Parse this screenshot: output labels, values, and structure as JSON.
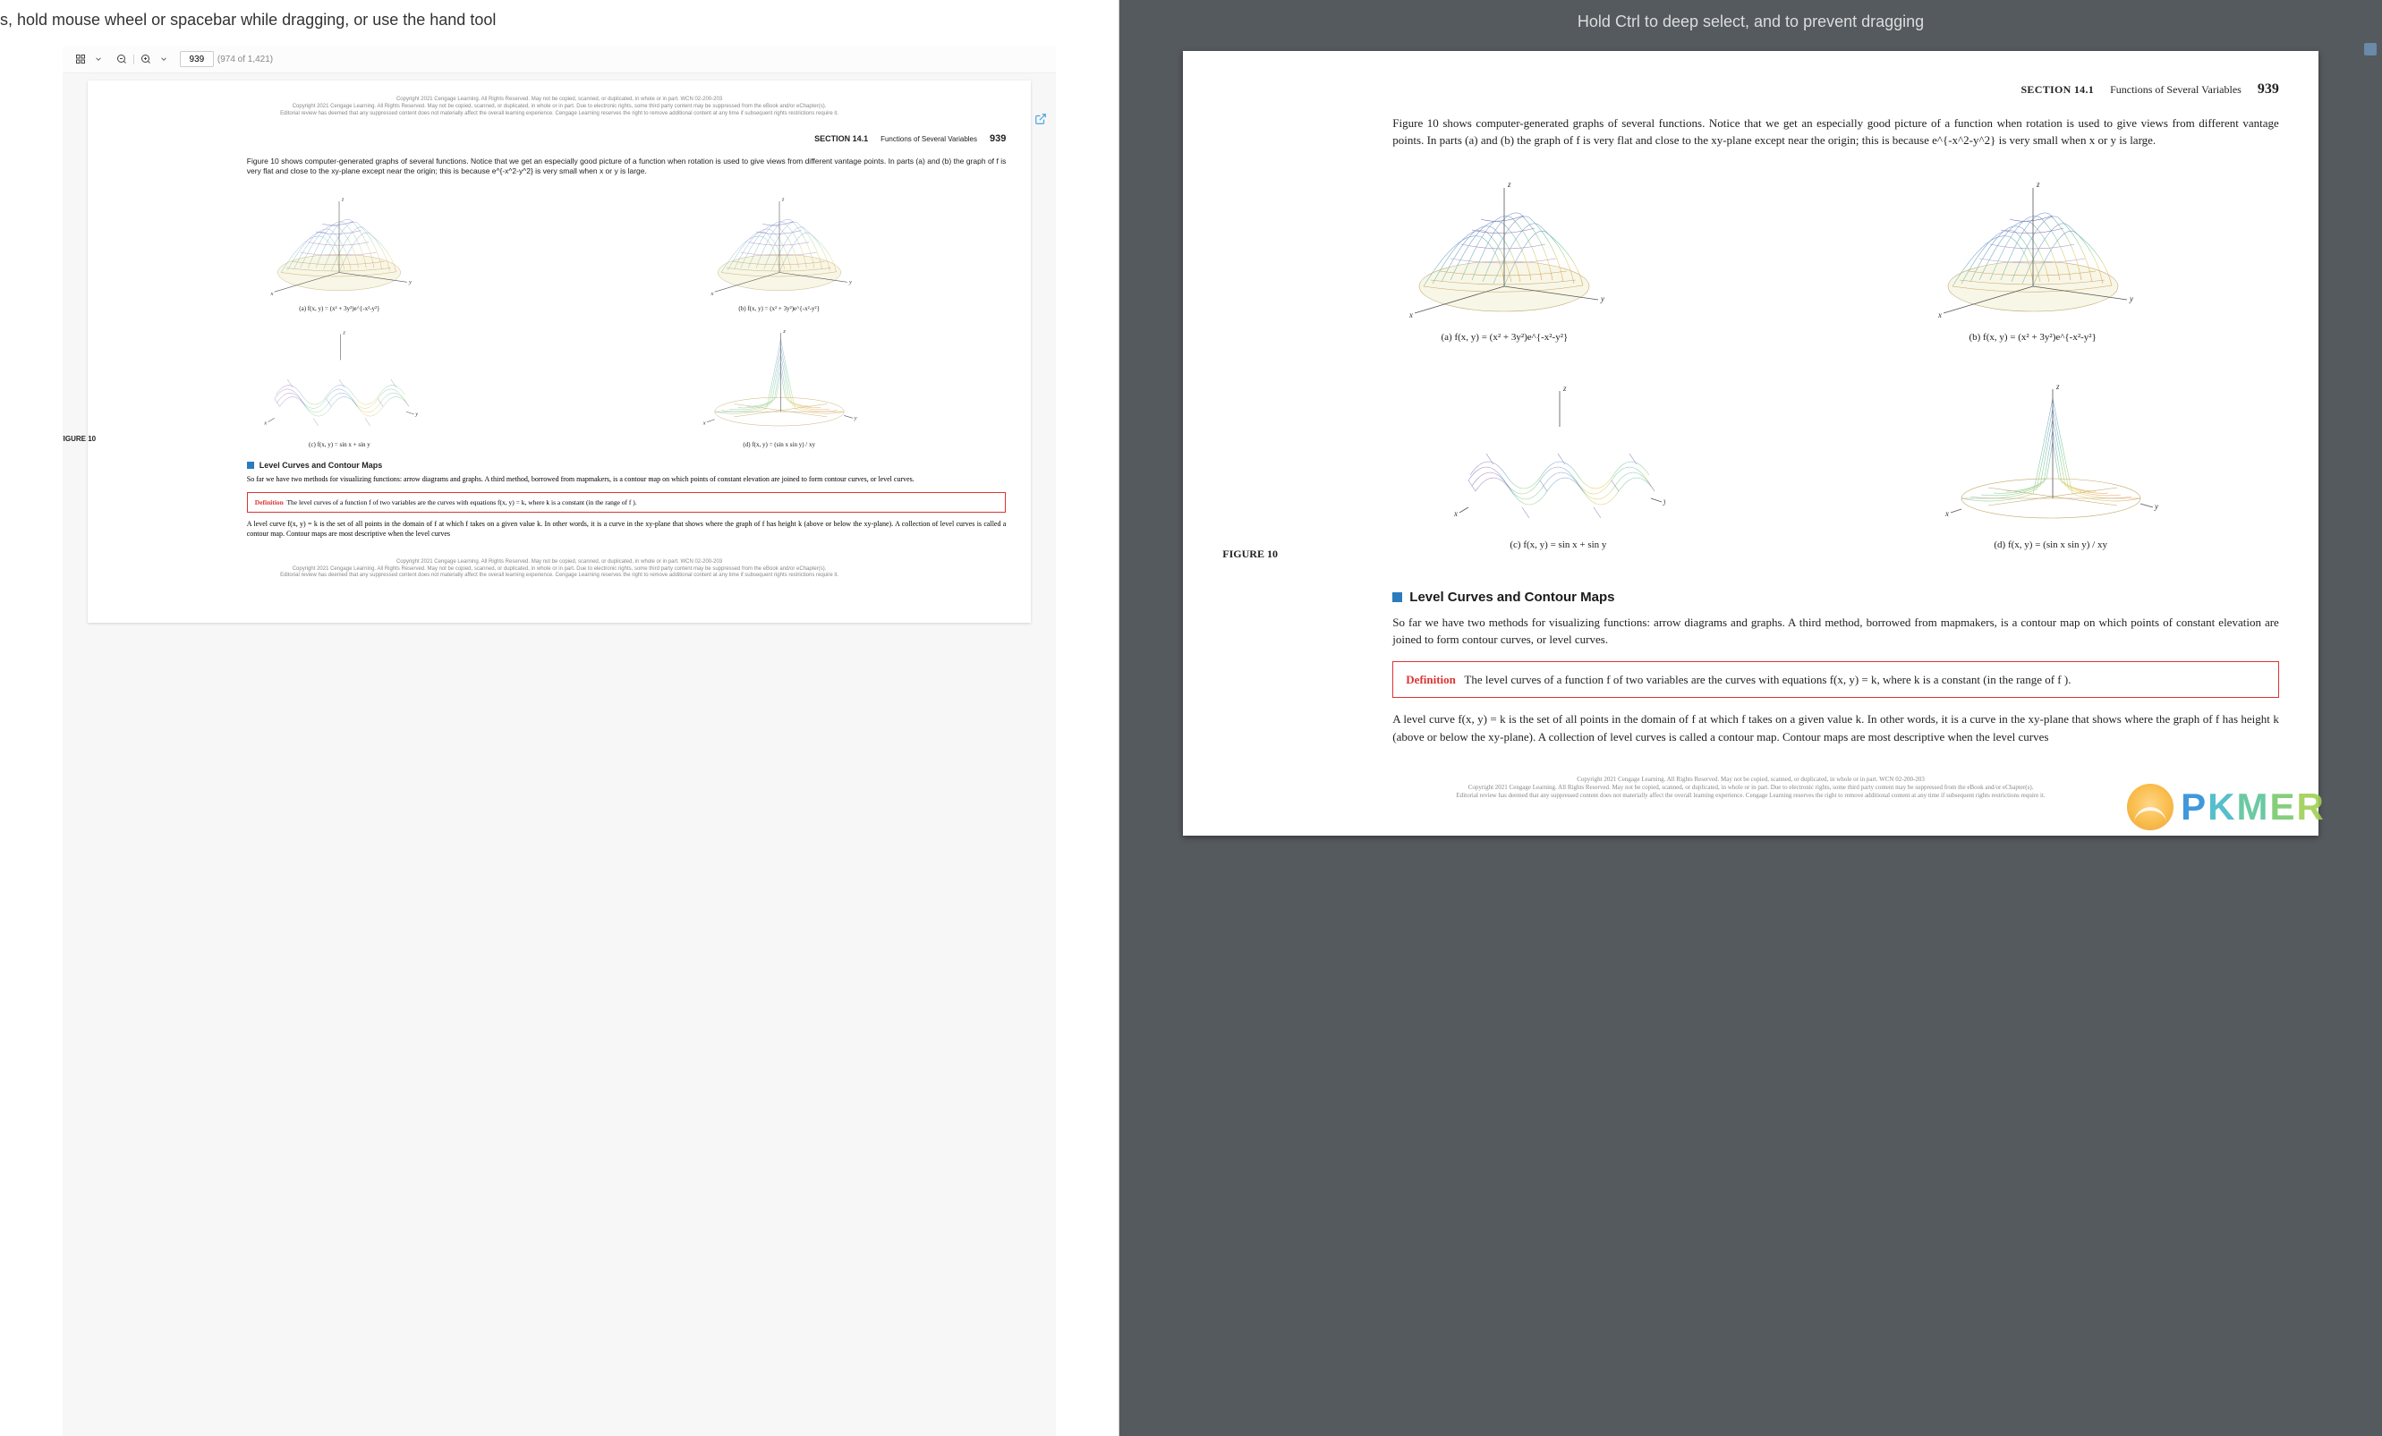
{
  "hints": {
    "left": "s, hold mouse wheel or spacebar while dragging, or use the hand tool",
    "right": "Hold Ctrl to deep select, and to prevent dragging"
  },
  "toolbar": {
    "current_page": "939",
    "page_total_label": "(974 of 1,421)"
  },
  "page_header": {
    "section": "SECTION 14.1",
    "title": "Functions of Several Variables",
    "page_number": "939"
  },
  "intro_text": "Figure 10 shows computer-generated graphs of several functions. Notice that we get an especially good picture of a function when rotation is used to give views from different vantage points. In parts (a) and (b) the graph of f is very flat and close to the xy-plane except near the origin; this is because e^{-x^2-y^2} is very small when x or y is large.",
  "figure_label": "FIGURE 10",
  "graphs": {
    "a": {
      "caption": "(a) f(x, y) = (x² + 3y²)e^{-x²-y²}"
    },
    "b": {
      "caption": "(b) f(x, y) = (x² + 3y²)e^{-x²-y²}"
    },
    "c": {
      "caption": "(c) f(x, y) = sin x + sin y"
    },
    "d": {
      "caption": "(d) f(x, y) = (sin x sin y) / xy"
    }
  },
  "section_heading": "Level Curves and Contour Maps",
  "body_para": "So far we have two methods for visualizing functions: arrow diagrams and graphs. A third method, borrowed from mapmakers, is a contour map on which points of constant elevation are joined to form contour curves, or level curves.",
  "definition": {
    "head": "Definition",
    "body": "The level curves of a function f of two variables are the curves with equations f(x, y) = k, where k is a constant (in the range of f )."
  },
  "body_para2": "A level curve f(x, y) = k is the set of all points in the domain of f at which f takes on a given value k. In other words, it is a curve in the xy-plane that shows where the graph of f has height k (above or below the xy-plane). A collection of level curves is called a contour map. Contour maps are most descriptive when the level curves",
  "copyright": {
    "line1": "Copyright 2021 Cengage Learning. All Rights Reserved. May not be copied, scanned, or duplicated, in whole or in part.  WCN 02-200-203",
    "line2": "Copyright 2021 Cengage Learning. All Rights Reserved. May not be copied, scanned, or duplicated, in whole or in part. Due to electronic rights, some third party content may be suppressed from the eBook and/or eChapter(s).",
    "line3": "Editorial review has deemed that any suppressed content does not materially affect the overall learning experience. Cengage Learning reserves the right to remove additional content at any time if subsequent rights restrictions require it."
  },
  "watermark": {
    "letters": [
      "P",
      "K",
      "M",
      "E",
      "R"
    ]
  }
}
